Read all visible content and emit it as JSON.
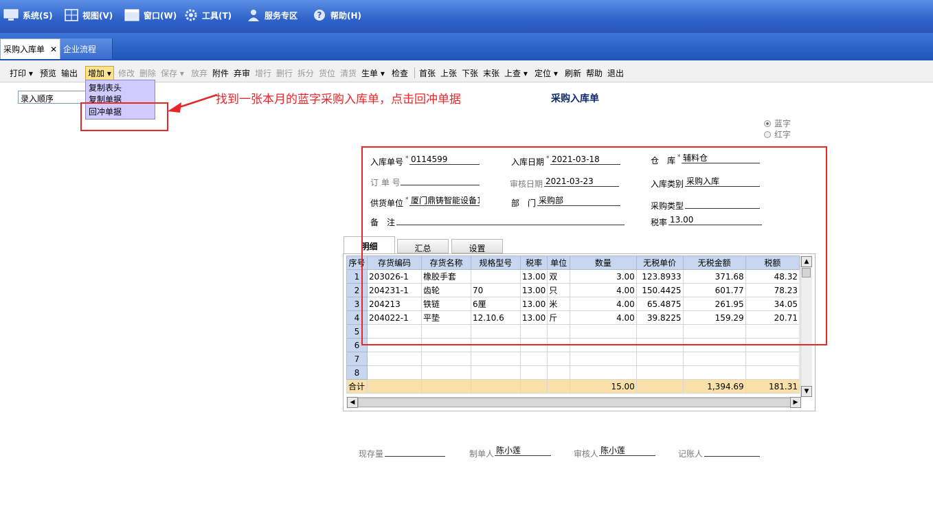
{
  "menubar": {
    "items": [
      {
        "label": "系统(S)",
        "icon": "monitor-icon"
      },
      {
        "label": "视图(V)",
        "icon": "grid-icon"
      },
      {
        "label": "窗口(W)",
        "icon": "window-icon"
      },
      {
        "label": "工具(T)",
        "icon": "gear-icon"
      },
      {
        "label": "服务专区",
        "icon": "user-icon"
      },
      {
        "label": "帮助(H)",
        "icon": "help-icon"
      }
    ]
  },
  "tabs": [
    {
      "label": "采购入库单",
      "close": "✕"
    },
    {
      "label": "企业流程"
    }
  ],
  "toolbar": {
    "items": [
      "打印 ▾",
      "预览",
      "输出",
      "增加 ▾",
      "修改",
      "删除",
      "保存 ▾",
      "放弃",
      "附件",
      "弃审",
      "增行",
      "删行",
      "拆分",
      "货位",
      "清货",
      "生单 ▾",
      "检查",
      "首张",
      "上张",
      "下张",
      "末张",
      "上查 ▾",
      "定位 ▾",
      "刷新",
      "帮助",
      "退出"
    ]
  },
  "dropdown": {
    "items": [
      "复制表头",
      "复制单据",
      "回冲单据"
    ]
  },
  "sort": {
    "value": "录入顺序"
  },
  "annotation": {
    "text": "找到一张本月的蓝字采购入库单，点击回冲单据"
  },
  "form": {
    "title": "采购入库单",
    "radio_blue": "蓝字",
    "radio_red": "红字",
    "l_no": "入库单号",
    "v_no": "0114599",
    "l_date": "入库日期",
    "v_date": "2021-03-18",
    "l_wh": "仓　库",
    "v_wh": "辅料仓",
    "l_order": "订 单 号",
    "v_order": "",
    "l_audit_date": "审核日期",
    "v_audit_date": "2021-03-23",
    "l_type": "入库类别",
    "v_type": "采购入库",
    "l_supplier": "供货单位",
    "v_supplier": "厦门鼎铸智能设备1",
    "l_dept": "部　门",
    "v_dept": "采购部",
    "l_ptype": "采购类型",
    "v_ptype": "",
    "l_remark": "备　注",
    "v_remark": "",
    "l_tax": "税率",
    "v_tax": "13.00",
    "req": "*"
  },
  "detail_tabs": [
    "明细",
    "汇总",
    "设置"
  ],
  "table": {
    "headers": [
      "序号",
      "存货编码",
      "存货名称",
      "规格型号",
      "税率",
      "单位",
      "数量",
      "无税单价",
      "无税金额",
      "税额"
    ],
    "rows": [
      [
        "1",
        "203026-1",
        "橡胶手套",
        "",
        "13.00",
        "双",
        "3.00",
        "123.8933",
        "371.68",
        "48.32"
      ],
      [
        "2",
        "204231-1",
        "齿轮",
        "70",
        "13.00",
        "只",
        "4.00",
        "150.4425",
        "601.77",
        "78.23"
      ],
      [
        "3",
        "204213",
        "铁链",
        "6厘",
        "13.00",
        "米",
        "4.00",
        "65.4875",
        "261.95",
        "34.05"
      ],
      [
        "4",
        "204022-1",
        "平垫",
        "12.10.6",
        "13.00",
        "斤",
        "4.00",
        "39.8225",
        "159.29",
        "20.71"
      ],
      [
        "5",
        "",
        "",
        "",
        "",
        "",
        "",
        "",
        "",
        ""
      ],
      [
        "6",
        "",
        "",
        "",
        "",
        "",
        "",
        "",
        "",
        ""
      ],
      [
        "7",
        "",
        "",
        "",
        "",
        "",
        "",
        "",
        "",
        ""
      ],
      [
        "8",
        "",
        "",
        "",
        "",
        "",
        "",
        "",
        "",
        ""
      ]
    ],
    "sum": [
      "合计",
      "",
      "",
      "",
      "",
      "",
      "15.00",
      "",
      "1,394.69",
      "181.31"
    ]
  },
  "footer": {
    "l_stock": "现存量",
    "v_stock": "",
    "l_maker": "制单人",
    "v_maker": "陈小莲",
    "l_auditor": "审核人",
    "v_auditor": "陈小莲",
    "l_book": "记账人",
    "v_book": ""
  },
  "colors": {
    "annotation": "#e8262a",
    "menubar": "#2f62c9",
    "header": "#c7d7ef",
    "sum": "#f9dfa8"
  }
}
